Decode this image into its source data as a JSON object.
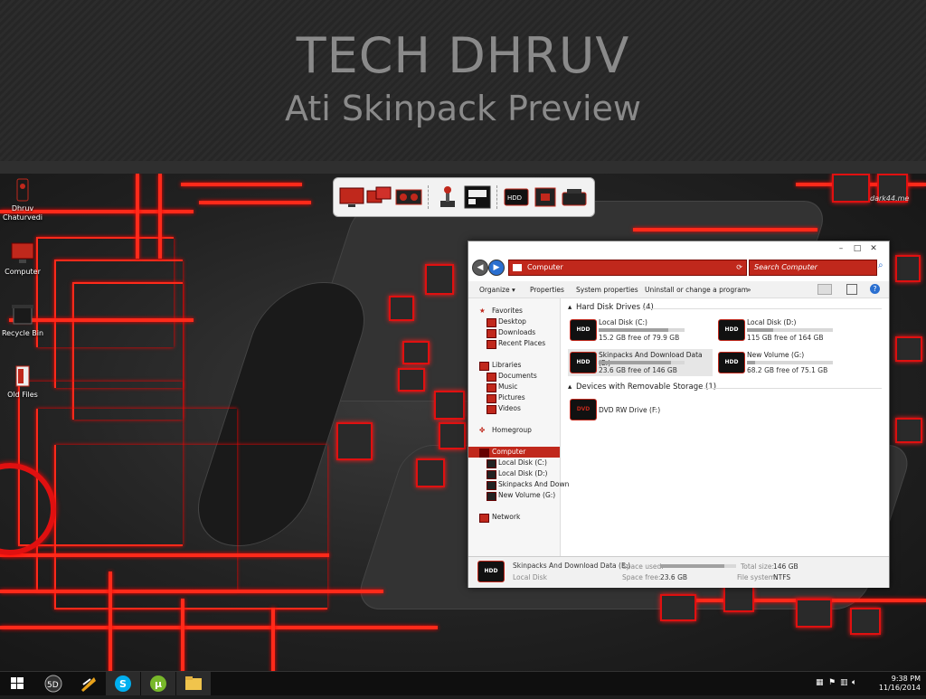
{
  "banner": {
    "title": "TECH DHRUV",
    "subtitle": "Ati Skinpack Preview"
  },
  "desktop_icons": [
    {
      "label": "Dhruv Chaturvedi",
      "icon": "user-icon"
    },
    {
      "label": "Computer",
      "icon": "monitor-icon"
    },
    {
      "label": "Recycle Bin",
      "icon": "recycle-bin-icon"
    },
    {
      "label": "Old Files",
      "icon": "folder-icon"
    }
  ],
  "watermark": "dark44.me",
  "dock": {
    "items": [
      "monitor-icon",
      "dual-monitor-icon",
      "dashboard-icon",
      "joystick-icon",
      "display-panel-icon",
      "hdd-icon",
      "cpu-icon",
      "drive-icon"
    ]
  },
  "explorer": {
    "address": "Computer",
    "search_placeholder": "Search Computer",
    "window_controls": [
      "–",
      "□",
      "✕"
    ],
    "toolbar": {
      "organize": "Organize",
      "properties": "Properties",
      "system_properties": "System properties",
      "uninstall": "Uninstall or change a program",
      "more": "»"
    },
    "nav": {
      "favorites": "Favorites",
      "desktop": "Desktop",
      "downloads": "Downloads",
      "recent": "Recent Places",
      "libraries": "Libraries",
      "documents": "Documents",
      "music": "Music",
      "pictures": "Pictures",
      "videos": "Videos",
      "homegroup": "Homegroup",
      "computer": "Computer",
      "c": "Local Disk (C:)",
      "d": "Local Disk (D:)",
      "e": "Skinpacks And Down",
      "g": "New Volume (G:)",
      "network": "Network"
    },
    "groups": {
      "hdd": "Hard Disk Drives (4)",
      "removable": "Devices with Removable Storage (1)"
    },
    "drives": [
      {
        "badge": "HDD",
        "name": "Local Disk (C:)",
        "free": "15.2 GB free of 79.9 GB",
        "used_fraction": 0.81
      },
      {
        "badge": "HDD",
        "name": "Local Disk (D:)",
        "free": "115 GB free of 164 GB",
        "used_fraction": 0.3
      },
      {
        "badge": "HDD",
        "name": "Skinpacks And Download Data (E:)",
        "free": "23.6 GB free of 146 GB",
        "used_fraction": 0.84
      },
      {
        "badge": "HDD",
        "name": "New Volume (G:)",
        "free": "68.2 GB free of 75.1 GB",
        "used_fraction": 0.09
      }
    ],
    "dvd": {
      "badge": "DVD",
      "name": "DVD RW Drive (F:)"
    },
    "details": {
      "name": "Skinpacks And Download Data (E:)",
      "type": "Local Disk",
      "space_used_label": "Space used:",
      "space_free_label": "Space free:",
      "space_free": "23.6 GB",
      "total_label": "Total size:",
      "total": "146 GB",
      "fs_label": "File system:",
      "fs": "NTFS",
      "used_fraction": 0.84
    }
  },
  "taskbar": {
    "buttons": [
      "windows-start-icon",
      "app-5d-icon",
      "winamp-icon",
      "skype-icon",
      "utorrent-icon",
      "file-explorer-icon"
    ],
    "time": "9:38 PM",
    "date": "11/16/2014"
  },
  "colors": {
    "accent": "#c0281c",
    "circuit": "#ff2a1a"
  }
}
